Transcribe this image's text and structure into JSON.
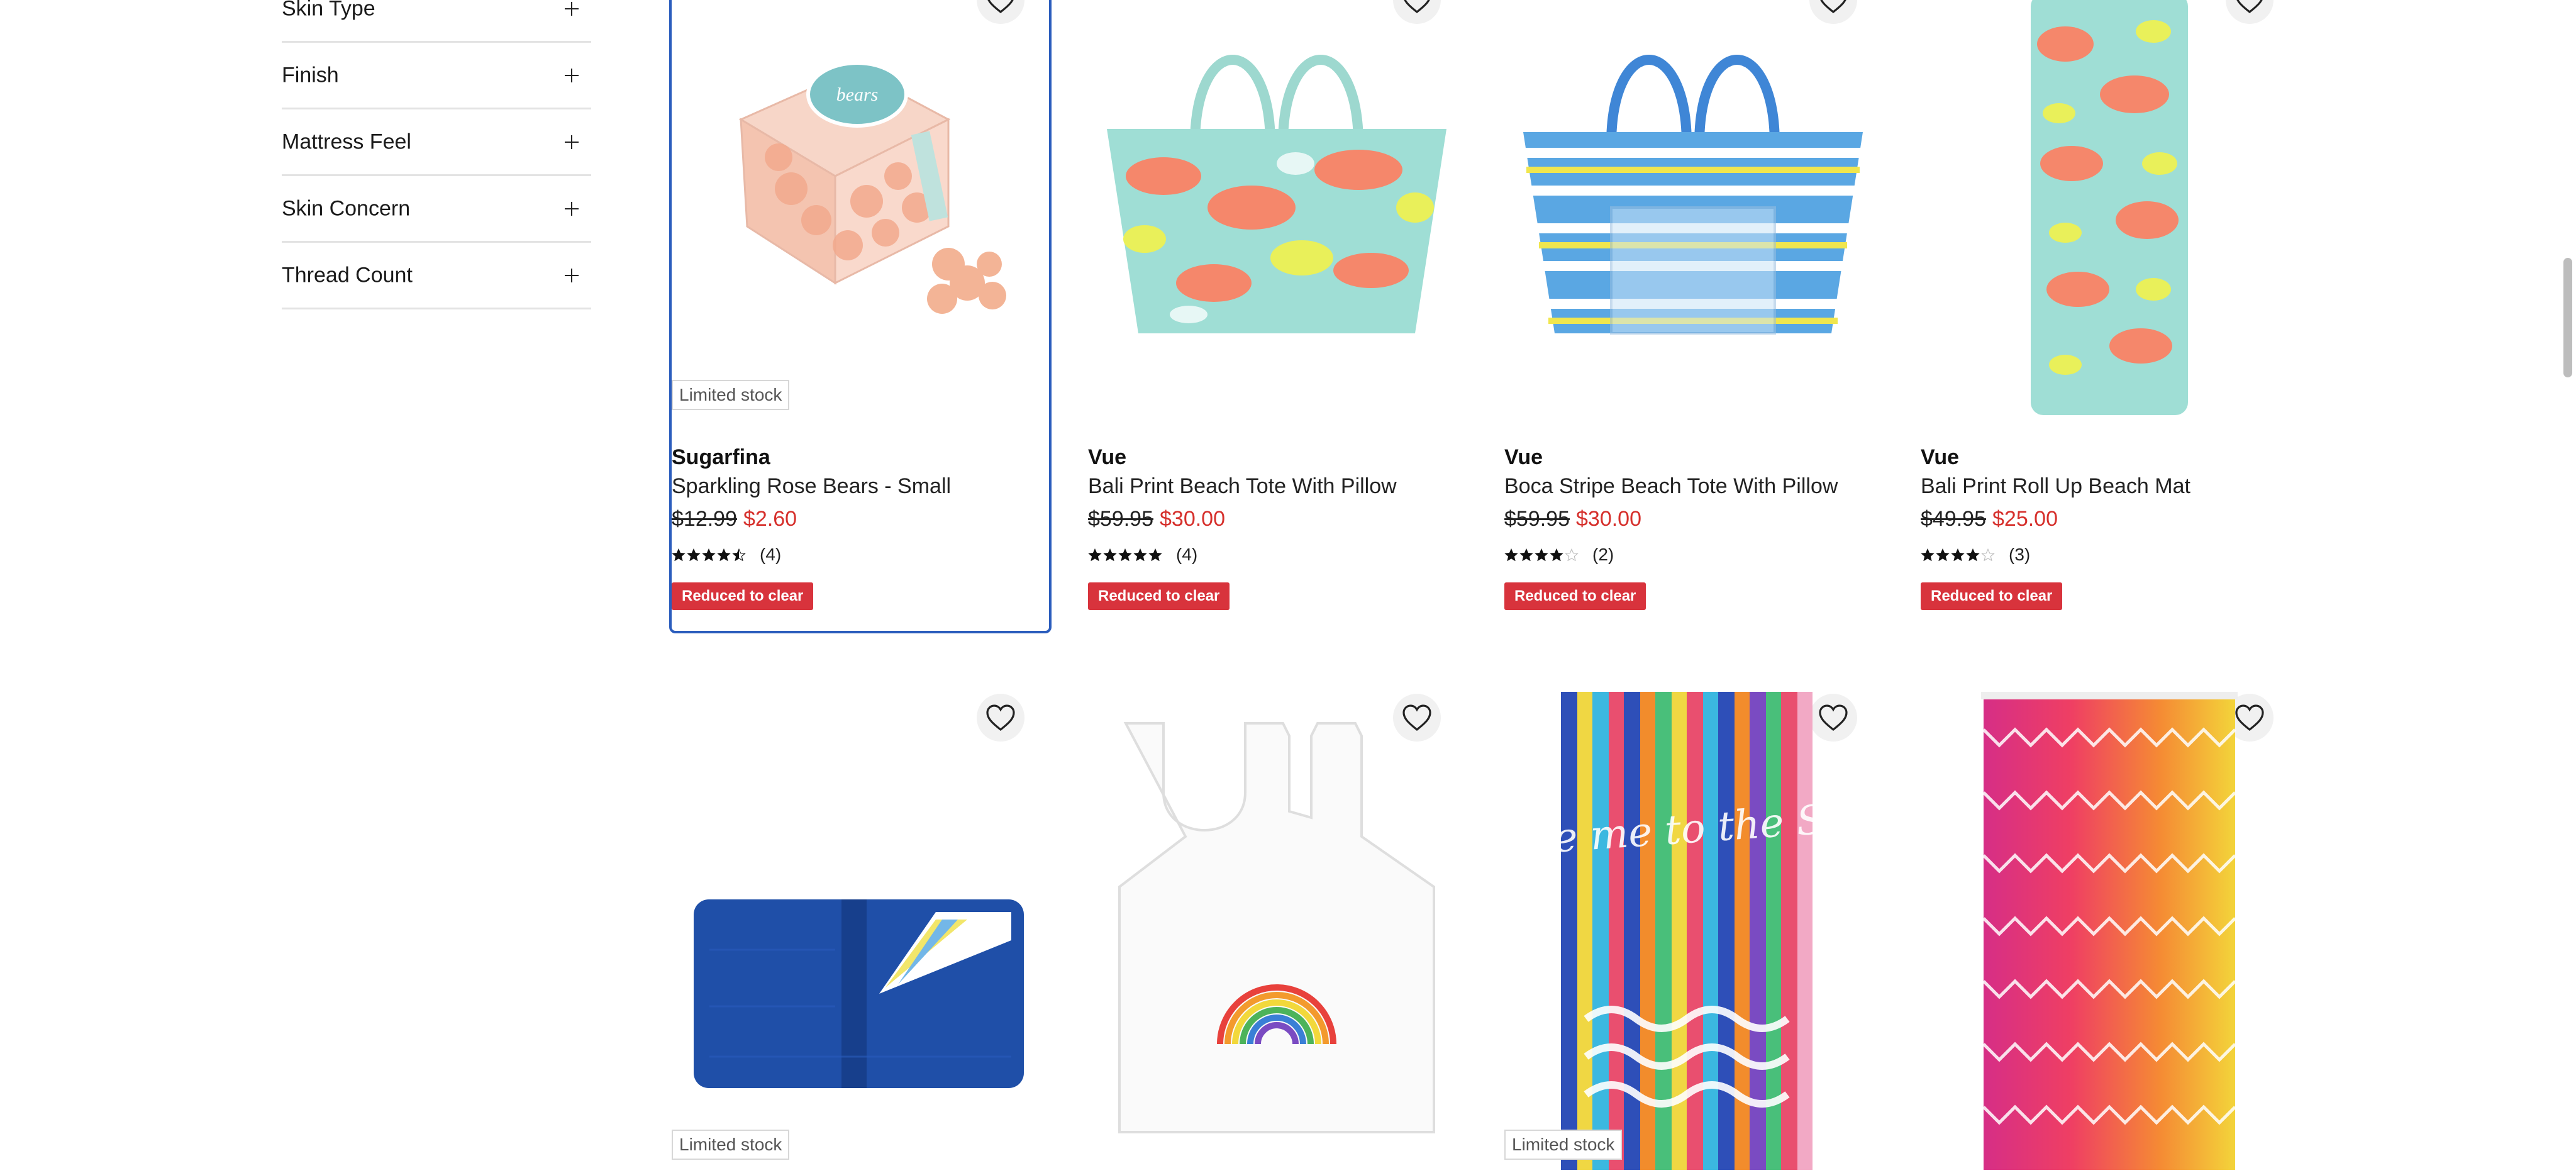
{
  "filters": [
    {
      "label": "Skin Type"
    },
    {
      "label": "Finish"
    },
    {
      "label": "Mattress Feel"
    },
    {
      "label": "Skin Concern"
    },
    {
      "label": "Thread Count"
    }
  ],
  "products_row1": [
    {
      "brand": "Sugarfina",
      "name": "Sparkling Rose Bears - Small",
      "original_price": "$12.99",
      "sale_price": "$2.60",
      "rating": 4.5,
      "review_count": "(4)",
      "badge": "Reduced to clear",
      "limited_stock": "Limited stock"
    },
    {
      "brand": "Vue",
      "name": "Bali Print Beach Tote With Pillow",
      "original_price": "$59.95",
      "sale_price": "$30.00",
      "rating": 5,
      "review_count": "(4)",
      "badge": "Reduced to clear"
    },
    {
      "brand": "Vue",
      "name": "Boca Stripe Beach Tote With Pillow",
      "original_price": "$59.95",
      "sale_price": "$30.00",
      "rating": 4,
      "review_count": "(2)",
      "badge": "Reduced to clear"
    },
    {
      "brand": "Vue",
      "name": "Bali Print Roll Up Beach Mat",
      "original_price": "$49.95",
      "sale_price": "$25.00",
      "rating": 4,
      "review_count": "(3)",
      "badge": "Reduced to clear"
    }
  ],
  "products_row2": [
    {
      "limited_stock": "Limited stock"
    },
    {},
    {
      "limited_stock": "Limited stock"
    },
    {}
  ],
  "product_images_text": {
    "bears_label": "bears",
    "towel_text": "take me to the SEA"
  },
  "icons": {
    "heart": "heart-icon",
    "plus": "plus-icon",
    "star": "star-icon"
  },
  "colors": {
    "sale": "#d6302c",
    "badge": "#d8333c",
    "focus": "#2b5dbd"
  }
}
